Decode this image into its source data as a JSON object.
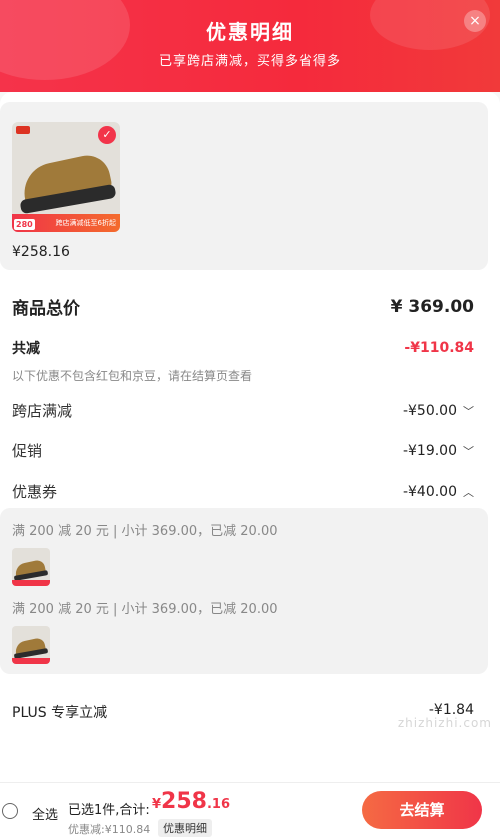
{
  "header": {
    "title": "优惠明细",
    "subtitle": "已享跨店满减，买得多省得多",
    "close_label": "×"
  },
  "goods": {
    "price": "¥258.16",
    "thumb_badge": "280",
    "thumb_promo": "跨店满减低至6折起"
  },
  "summary": {
    "total_label": "商品总价",
    "total_value": "¥ 369.00",
    "discount_label": "共减",
    "discount_value": "-¥110.84",
    "note": "以下优惠不包含红包和京豆，请在结算页查看"
  },
  "discounts": [
    {
      "label": "跨店满减",
      "value": "-¥50.00",
      "chevron": "down"
    },
    {
      "label": "促销",
      "value": "-¥19.00",
      "chevron": "down"
    },
    {
      "label": "优惠券",
      "value": "-¥40.00",
      "chevron": "up"
    }
  ],
  "coupons": [
    {
      "text": "满 200 减 20 元 | 小计 369.00，已减 20.00"
    },
    {
      "text": "满 200 减 20 元 | 小计 369.00，已减 20.00"
    }
  ],
  "plus": {
    "label": "PLUS 专享立减",
    "value": "-¥1.84"
  },
  "footer": {
    "select_all": "全选",
    "selected_text": "已选1件,合计:",
    "amount_prefix": "¥",
    "amount_int": "258",
    "amount_dec": ".16",
    "saved_text": "优惠减:¥110.84",
    "detail_tag": "优惠明细",
    "checkout_label": "去结算"
  },
  "watermark": "zhizhizhi.com",
  "colors": {
    "brand_red": "#f03548",
    "header_red": "#f5334a"
  }
}
